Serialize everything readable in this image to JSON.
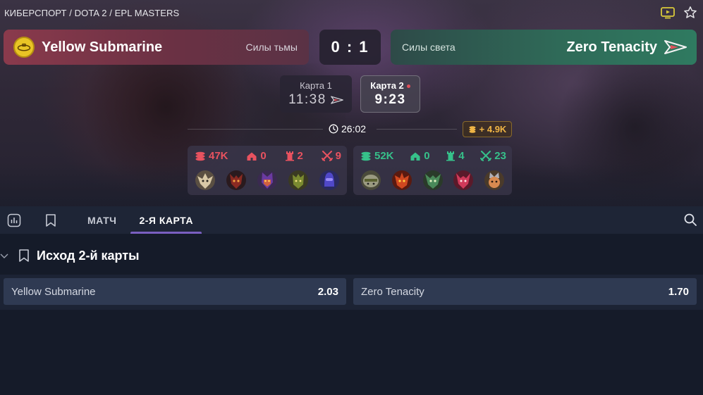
{
  "breadcrumb": "КИБЕРСПОРТ / DOTA 2 / EPL MASTERS",
  "top_icons": [
    "tv-icon",
    "star-icon"
  ],
  "match": {
    "team1": {
      "name": "Yellow Submarine",
      "side": "Силы тьмы",
      "color": "#8a3a4c"
    },
    "team2": {
      "name": "Zero Tenacity",
      "side": "Силы света",
      "color": "#2f7a60"
    },
    "score": "0 : 1"
  },
  "maps": [
    {
      "label": "Карта 1",
      "time": "11:38"
    },
    {
      "label": "Карта 2",
      "time": "9:23",
      "live": true
    }
  ],
  "game_timer": "26:02",
  "gold_lead": "+ 4.9K",
  "stats": {
    "team1": {
      "gold": "47K",
      "towers_destroyed": "0",
      "barracks": "2",
      "kills": "9"
    },
    "team2": {
      "gold": "52K",
      "towers_destroyed": "0",
      "barracks": "4",
      "kills": "23"
    }
  },
  "heroes": {
    "team1": [
      "hero-icon-1",
      "hero-icon-2",
      "hero-icon-3",
      "hero-icon-4",
      "hero-icon-5"
    ],
    "team2": [
      "hero-icon-6",
      "hero-icon-7",
      "hero-icon-8",
      "hero-icon-9",
      "hero-icon-10"
    ]
  },
  "tabs": {
    "items": [
      {
        "label": "МАТЧ"
      },
      {
        "label": "2-Я КАРТА",
        "active": true
      }
    ]
  },
  "market": {
    "title": "Исход 2-й карты",
    "outcomes": [
      {
        "name": "Yellow Submarine",
        "odd": "2.03"
      },
      {
        "name": "Zero Tenacity",
        "odd": "1.70"
      }
    ]
  },
  "colors": {
    "accent": "#7a5fc0",
    "red": "#e8525f",
    "green": "#36c08a",
    "gold": "#f0b545"
  }
}
